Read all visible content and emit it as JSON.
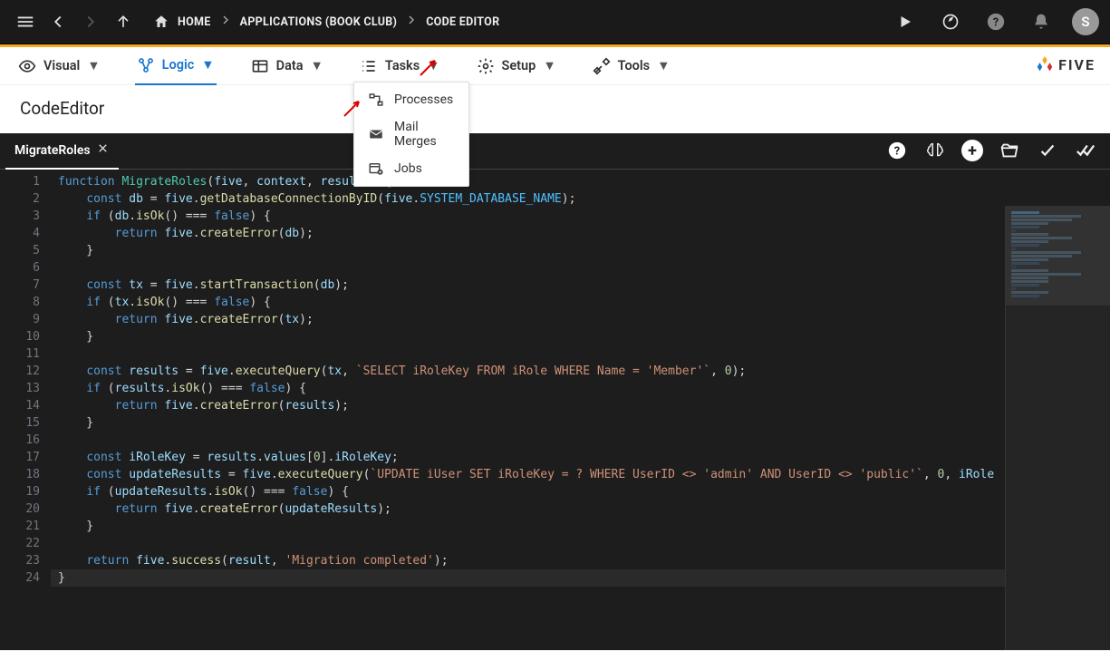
{
  "topbar": {
    "breadcrumbs": [
      {
        "icon": "home",
        "label": "HOME"
      },
      {
        "label": "APPLICATIONS (BOOK CLUB)"
      },
      {
        "label": "CODE EDITOR"
      }
    ],
    "avatar_letter": "S"
  },
  "menu": {
    "items": [
      {
        "label": "Visual",
        "icon": "eye",
        "active": false
      },
      {
        "label": "Logic",
        "icon": "flow",
        "active": true
      },
      {
        "label": "Data",
        "icon": "table",
        "active": false
      },
      {
        "label": "Tasks",
        "icon": "list",
        "active": false,
        "dropdown_open": true
      },
      {
        "label": "Setup",
        "icon": "gear",
        "active": false
      },
      {
        "label": "Tools",
        "icon": "wrench",
        "active": false
      }
    ],
    "logo_text": "FIVE"
  },
  "title": "CodeEditor",
  "tasks_dropdown": {
    "items": [
      {
        "label": "Processes",
        "icon": "process"
      },
      {
        "label": "Mail Merges",
        "icon": "mail"
      },
      {
        "label": "Jobs",
        "icon": "calendar-gear"
      }
    ]
  },
  "editor": {
    "tab": {
      "label": "MigrateRoles"
    },
    "actions": [
      "help",
      "brain",
      "add",
      "open",
      "check",
      "check-all"
    ],
    "highlight_line": 24,
    "code_lines": [
      [
        [
          "kw",
          "function"
        ],
        [
          "op",
          " "
        ],
        [
          "fn",
          "MigrateRoles"
        ],
        [
          "op",
          "("
        ],
        [
          "va",
          "five"
        ],
        [
          "op",
          ", "
        ],
        [
          "va",
          "context"
        ],
        [
          "op",
          ", "
        ],
        [
          "va",
          "result"
        ],
        [
          "op",
          ")  {"
        ]
      ],
      [
        [
          "op",
          "    "
        ],
        [
          "kw",
          "const"
        ],
        [
          "op",
          " "
        ],
        [
          "va",
          "db"
        ],
        [
          "op",
          " = "
        ],
        [
          "va",
          "five"
        ],
        [
          "op",
          "."
        ],
        [
          "dc",
          "getDatabaseConnectionByID"
        ],
        [
          "op",
          "("
        ],
        [
          "va",
          "five"
        ],
        [
          "op",
          "."
        ],
        [
          "cn",
          "SYSTEM_DATABASE_NAME"
        ],
        [
          "op",
          ");"
        ]
      ],
      [
        [
          "op",
          "    "
        ],
        [
          "kw",
          "if"
        ],
        [
          "op",
          " ("
        ],
        [
          "va",
          "db"
        ],
        [
          "op",
          "."
        ],
        [
          "dc",
          "isOk"
        ],
        [
          "op",
          "() === "
        ],
        [
          "kw",
          "false"
        ],
        [
          "op",
          ") {"
        ]
      ],
      [
        [
          "op",
          "        "
        ],
        [
          "kw",
          "return"
        ],
        [
          "op",
          " "
        ],
        [
          "va",
          "five"
        ],
        [
          "op",
          "."
        ],
        [
          "dc",
          "createError"
        ],
        [
          "op",
          "("
        ],
        [
          "va",
          "db"
        ],
        [
          "op",
          ");"
        ]
      ],
      [
        [
          "op",
          "    }"
        ]
      ],
      [],
      [
        [
          "op",
          "    "
        ],
        [
          "kw",
          "const"
        ],
        [
          "op",
          " "
        ],
        [
          "va",
          "tx"
        ],
        [
          "op",
          " = "
        ],
        [
          "va",
          "five"
        ],
        [
          "op",
          "."
        ],
        [
          "dc",
          "startTransaction"
        ],
        [
          "op",
          "("
        ],
        [
          "va",
          "db"
        ],
        [
          "op",
          ");"
        ]
      ],
      [
        [
          "op",
          "    "
        ],
        [
          "kw",
          "if"
        ],
        [
          "op",
          " ("
        ],
        [
          "va",
          "tx"
        ],
        [
          "op",
          "."
        ],
        [
          "dc",
          "isOk"
        ],
        [
          "op",
          "() === "
        ],
        [
          "kw",
          "false"
        ],
        [
          "op",
          ") {"
        ]
      ],
      [
        [
          "op",
          "        "
        ],
        [
          "kw",
          "return"
        ],
        [
          "op",
          " "
        ],
        [
          "va",
          "five"
        ],
        [
          "op",
          "."
        ],
        [
          "dc",
          "createError"
        ],
        [
          "op",
          "("
        ],
        [
          "va",
          "tx"
        ],
        [
          "op",
          ");"
        ]
      ],
      [
        [
          "op",
          "    }"
        ]
      ],
      [],
      [
        [
          "op",
          "    "
        ],
        [
          "kw",
          "const"
        ],
        [
          "op",
          " "
        ],
        [
          "va",
          "results"
        ],
        [
          "op",
          " = "
        ],
        [
          "va",
          "five"
        ],
        [
          "op",
          "."
        ],
        [
          "dc",
          "executeQuery"
        ],
        [
          "op",
          "("
        ],
        [
          "va",
          "tx"
        ],
        [
          "op",
          ", "
        ],
        [
          "st",
          "`SELECT iRoleKey FROM iRole WHERE Name = 'Member'`"
        ],
        [
          "op",
          ", "
        ],
        [
          "nu",
          "0"
        ],
        [
          "op",
          ");"
        ]
      ],
      [
        [
          "op",
          "    "
        ],
        [
          "kw",
          "if"
        ],
        [
          "op",
          " ("
        ],
        [
          "va",
          "results"
        ],
        [
          "op",
          "."
        ],
        [
          "dc",
          "isOk"
        ],
        [
          "op",
          "() === "
        ],
        [
          "kw",
          "false"
        ],
        [
          "op",
          ") {"
        ]
      ],
      [
        [
          "op",
          "        "
        ],
        [
          "kw",
          "return"
        ],
        [
          "op",
          " "
        ],
        [
          "va",
          "five"
        ],
        [
          "op",
          "."
        ],
        [
          "dc",
          "createError"
        ],
        [
          "op",
          "("
        ],
        [
          "va",
          "results"
        ],
        [
          "op",
          ");"
        ]
      ],
      [
        [
          "op",
          "    }"
        ]
      ],
      [],
      [
        [
          "op",
          "    "
        ],
        [
          "kw",
          "const"
        ],
        [
          "op",
          " "
        ],
        [
          "va",
          "iRoleKey"
        ],
        [
          "op",
          " = "
        ],
        [
          "va",
          "results"
        ],
        [
          "op",
          "."
        ],
        [
          "va",
          "values"
        ],
        [
          "op",
          "["
        ],
        [
          "nu",
          "0"
        ],
        [
          "op",
          "]."
        ],
        [
          "va",
          "iRoleKey"
        ],
        [
          "op",
          ";"
        ]
      ],
      [
        [
          "op",
          "    "
        ],
        [
          "kw",
          "const"
        ],
        [
          "op",
          " "
        ],
        [
          "va",
          "updateResults"
        ],
        [
          "op",
          " = "
        ],
        [
          "va",
          "five"
        ],
        [
          "op",
          "."
        ],
        [
          "dc",
          "executeQuery"
        ],
        [
          "op",
          "("
        ],
        [
          "st",
          "`UPDATE iUser SET iRoleKey = ? WHERE UserID <> 'admin' AND UserID <> 'public'`"
        ],
        [
          "op",
          ", "
        ],
        [
          "nu",
          "0"
        ],
        [
          "op",
          ", "
        ],
        [
          "va",
          "iRole"
        ]
      ],
      [
        [
          "op",
          "    "
        ],
        [
          "kw",
          "if"
        ],
        [
          "op",
          " ("
        ],
        [
          "va",
          "updateResults"
        ],
        [
          "op",
          "."
        ],
        [
          "dc",
          "isOk"
        ],
        [
          "op",
          "() === "
        ],
        [
          "kw",
          "false"
        ],
        [
          "op",
          ") {"
        ]
      ],
      [
        [
          "op",
          "        "
        ],
        [
          "kw",
          "return"
        ],
        [
          "op",
          " "
        ],
        [
          "va",
          "five"
        ],
        [
          "op",
          "."
        ],
        [
          "dc",
          "createError"
        ],
        [
          "op",
          "("
        ],
        [
          "va",
          "updateResults"
        ],
        [
          "op",
          ");"
        ]
      ],
      [
        [
          "op",
          "    }"
        ]
      ],
      [],
      [
        [
          "op",
          "    "
        ],
        [
          "kw",
          "return"
        ],
        [
          "op",
          " "
        ],
        [
          "va",
          "five"
        ],
        [
          "op",
          "."
        ],
        [
          "dc",
          "success"
        ],
        [
          "op",
          "("
        ],
        [
          "va",
          "result"
        ],
        [
          "op",
          ", "
        ],
        [
          "st",
          "'Migration completed'"
        ],
        [
          "op",
          ");"
        ]
      ],
      [
        [
          "op",
          "}"
        ]
      ]
    ]
  }
}
